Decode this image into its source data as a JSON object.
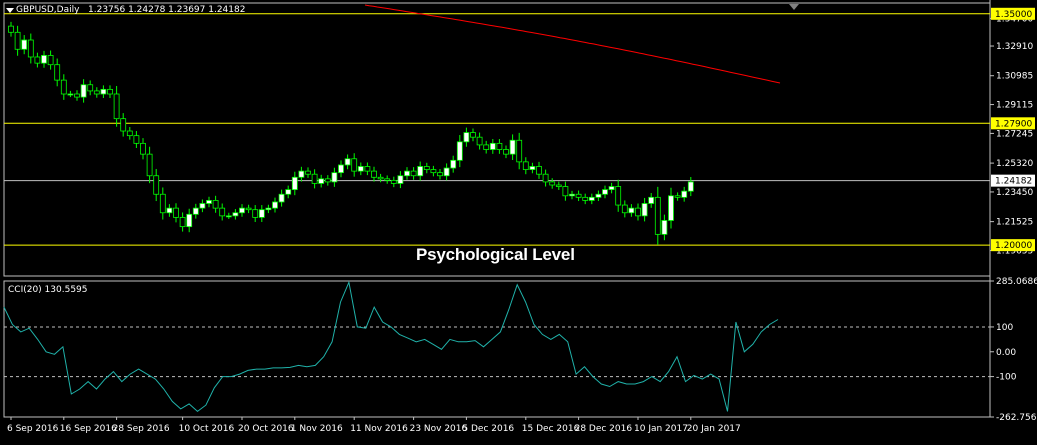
{
  "window": {
    "symbol_label": "GBPUSD,Daily",
    "ohlc_label": "1.23756 1.24278 1.23697 1.24182",
    "annotation": "Psychological Level",
    "indicator_label": "CCI(20) 130.5595"
  },
  "colors": {
    "background": "#000000",
    "bull_candle": "#ffffff",
    "bear_candle": "#000000",
    "candle_wick": "#00ff00",
    "moving_average": "#ff0000",
    "horizontal_level": "#ffff00",
    "price_line": "#c0c0c0",
    "cci_line": "#20b2aa"
  },
  "chart_data": [
    {
      "type": "candlestick",
      "title": "GBPUSD,Daily",
      "ylim": [
        1.18,
        1.357
      ],
      "price_ticks": [
        "1.34700",
        "1.32910",
        "1.30985",
        "1.29115",
        "1.27245",
        "1.25320",
        "1.23450",
        "1.21525",
        "1.19655"
      ],
      "highlighted_levels": [
        {
          "label": "1.35000",
          "value": 1.35
        },
        {
          "label": "1.27900",
          "value": 1.279
        },
        {
          "label": "1.20000",
          "value": 1.2
        }
      ],
      "current_price": {
        "label": "1.24182",
        "value": 1.24182
      },
      "date_labels": [
        {
          "label": "6 Sep 2016",
          "index": 0
        },
        {
          "label": "16 Sep 2016",
          "index": 8
        },
        {
          "label": "28 Sep 2016",
          "index": 16
        },
        {
          "label": "10 Oct 2016",
          "index": 26
        },
        {
          "label": "20 Oct 2016",
          "index": 35
        },
        {
          "label": "1 Nov 2016",
          "index": 43
        },
        {
          "label": "11 Nov 2016",
          "index": 52
        },
        {
          "label": "23 Nov 2016",
          "index": 61
        },
        {
          "label": "5 Dec 2016",
          "index": 69
        },
        {
          "label": "15 Dec 2016",
          "index": 78
        },
        {
          "label": "28 Dec 2016",
          "index": 86
        },
        {
          "label": "10 Jan 2017",
          "index": 95
        },
        {
          "label": "20 Jan 2017",
          "index": 103
        }
      ],
      "closes": [
        1.338,
        1.327,
        1.333,
        1.322,
        1.318,
        1.323,
        1.317,
        1.307,
        1.298,
        1.298,
        1.296,
        1.304,
        1.3,
        1.298,
        1.301,
        1.298,
        1.282,
        1.274,
        1.271,
        1.266,
        1.259,
        1.245,
        1.233,
        1.221,
        1.224,
        1.218,
        1.212,
        1.22,
        1.224,
        1.227,
        1.229,
        1.224,
        1.219,
        1.219,
        1.221,
        1.224,
        1.223,
        1.218,
        1.223,
        1.224,
        1.228,
        1.233,
        1.236,
        1.244,
        1.248,
        1.246,
        1.24,
        1.243,
        1.241,
        1.247,
        1.252,
        1.256,
        1.248,
        1.251,
        1.248,
        1.244,
        1.243,
        1.242,
        1.24,
        1.245,
        1.248,
        1.245,
        1.251,
        1.249,
        1.247,
        1.245,
        1.25,
        1.255,
        1.267,
        1.273,
        1.27,
        1.265,
        1.262,
        1.266,
        1.262,
        1.259,
        1.268,
        1.254,
        1.249,
        1.251,
        1.246,
        1.241,
        1.239,
        1.238,
        1.232,
        1.233,
        1.231,
        1.229,
        1.231,
        1.233,
        1.236,
        1.238,
        1.226,
        1.221,
        1.224,
        1.219,
        1.227,
        1.231,
        1.207,
        1.216,
        1.232,
        1.231,
        1.235,
        1.241
      ]
    },
    {
      "type": "line",
      "title": "CCI(20) 130.5595",
      "ylim": [
        -262.7568,
        285.0686
      ],
      "ticks": [
        {
          "label": "285.0686",
          "value": 285.0686
        },
        {
          "label": "100",
          "value": 100
        },
        {
          "label": "0.00",
          "value": 0
        },
        {
          "label": "-100",
          "value": -100
        },
        {
          "label": "-262.7568",
          "value": -262.7568
        }
      ],
      "levels": [
        100,
        -100
      ],
      "values": [
        180,
        110,
        80,
        95,
        50,
        0,
        -10,
        20,
        -170,
        -150,
        -120,
        -150,
        -110,
        -80,
        -120,
        -90,
        -70,
        -90,
        -110,
        -150,
        -200,
        -230,
        -210,
        -240,
        -215,
        -145,
        -100,
        -100,
        -90,
        -75,
        -70,
        -70,
        -65,
        -65,
        -63,
        -55,
        -60,
        -55,
        -20,
        40,
        200,
        280,
        100,
        95,
        180,
        120,
        100,
        70,
        55,
        40,
        50,
        30,
        10,
        50,
        40,
        40,
        45,
        20,
        50,
        80,
        170,
        270,
        200,
        110,
        70,
        50,
        70,
        40,
        -90,
        -60,
        -100,
        -130,
        -140,
        -120,
        -130,
        -130,
        -120,
        -100,
        -120,
        -80,
        -20,
        -120,
        -95,
        -110,
        -90,
        -110,
        -240,
        120,
        0,
        30,
        80,
        110,
        130
      ]
    }
  ]
}
